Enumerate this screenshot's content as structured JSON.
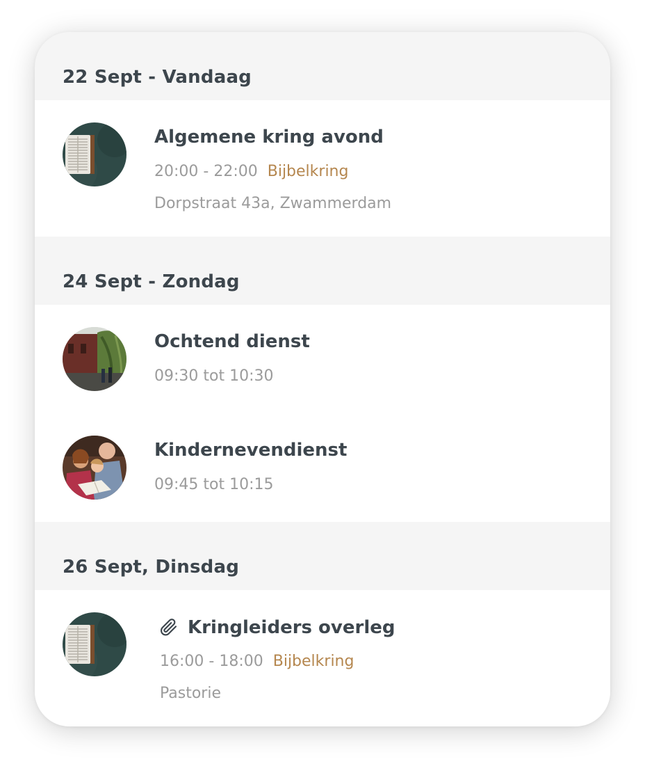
{
  "days": [
    {
      "header": "22 Sept - Vandaag",
      "events": [
        {
          "title": "Algemene kring avond",
          "time": "20:00 - 22:00",
          "category": "Bijbelkring",
          "location": "Dorpstraat 43a, Zwammerdam",
          "icon": "bible-photo"
        }
      ]
    },
    {
      "header": "24 Sept - Zondag",
      "events": [
        {
          "title": "Ochtend dienst",
          "time": "09:30 tot 10:30",
          "icon": "church-photo"
        },
        {
          "title": "Kindernevendienst",
          "time": "09:45 tot 10:15",
          "icon": "children-reading-photo"
        }
      ]
    },
    {
      "header": "26 Sept, Dinsdag",
      "events": [
        {
          "title": "Kringleiders overleg",
          "time": "16:00 - 18:00",
          "category": "Bijbelkring",
          "location": "Pastorie",
          "icon": "bible-photo",
          "attachment_icon": "paperclip-icon"
        }
      ]
    }
  ],
  "colors": {
    "heading": "#3d464d",
    "muted": "#9b9b9b",
    "category": "#b5874f",
    "section_bg": "#f5f5f5",
    "event_bg": "#ffffff"
  }
}
